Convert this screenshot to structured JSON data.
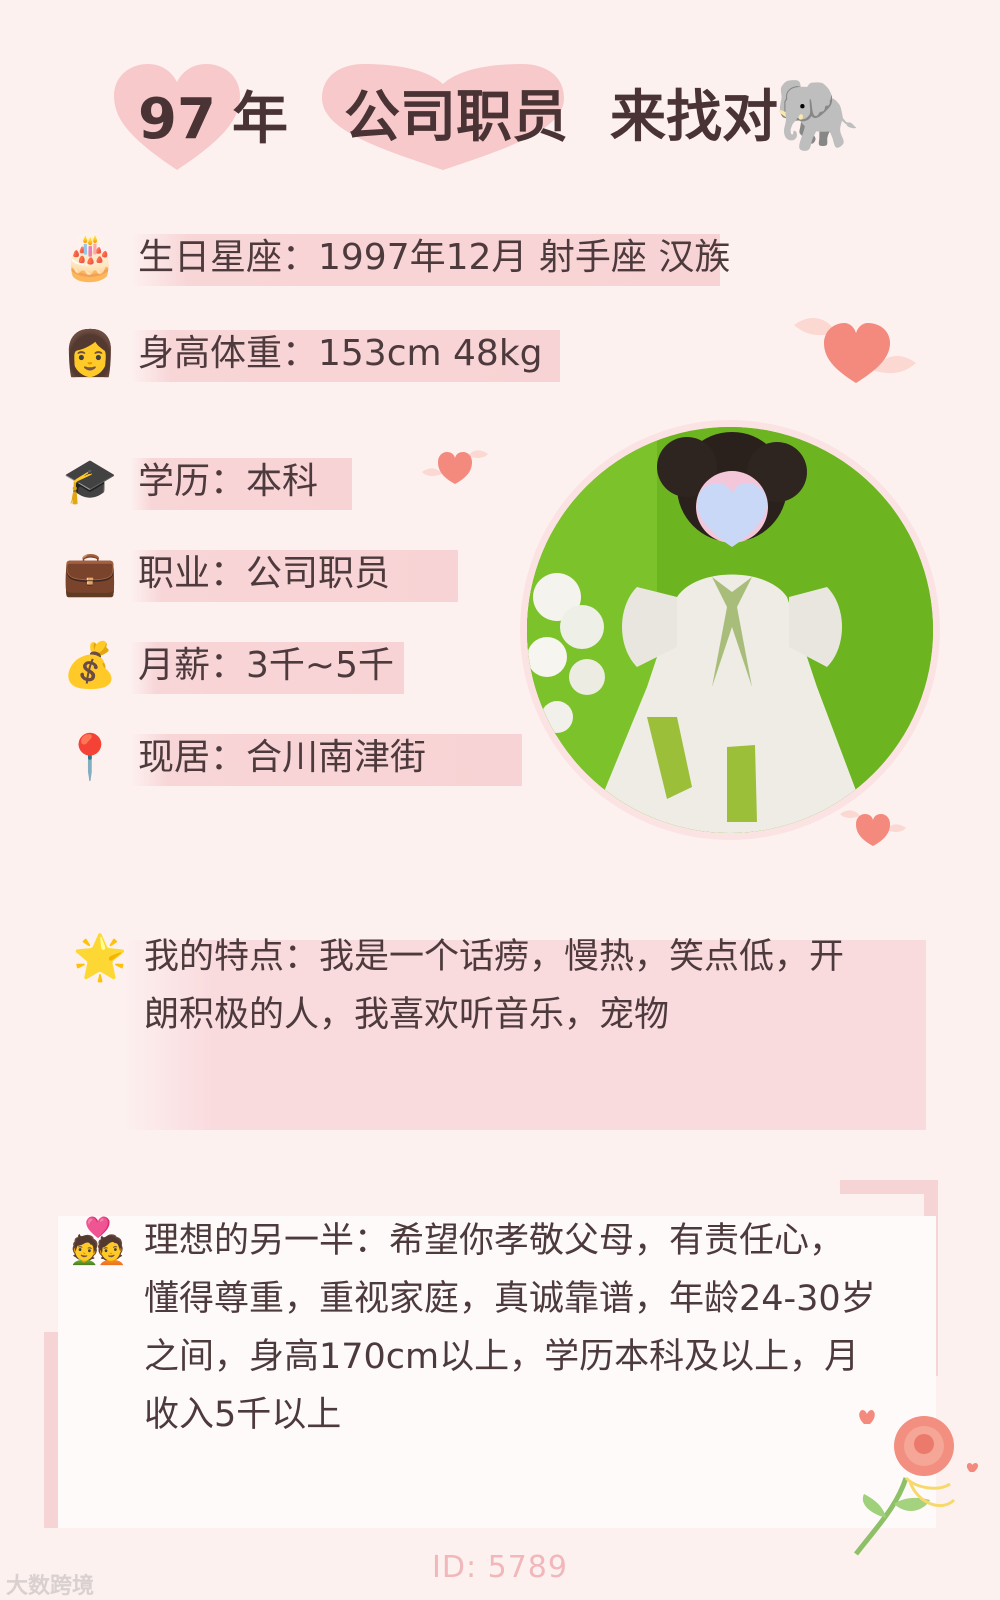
{
  "header": {
    "year": "97",
    "year_suffix": "年",
    "occupation": "公司职员",
    "tagline": "来找对",
    "emoji": "🐘"
  },
  "info": {
    "birthday": {
      "icon": "🎂",
      "icon_name": "birthday-cake-icon",
      "text": "生日星座：1997年12月 射手座 汉族"
    },
    "height_weight": {
      "icon": "👩",
      "icon_name": "woman-icon",
      "text": "身高体重：153cm 48kg"
    },
    "education": {
      "icon": "🎓",
      "icon_name": "graduation-cap-icon",
      "text": "学历：本科"
    },
    "job": {
      "icon": "💼",
      "icon_name": "briefcase-icon",
      "text": "职业：公司职员"
    },
    "salary": {
      "icon": "💰",
      "icon_name": "money-bag-icon",
      "text": "月薪：3千~5千"
    },
    "residence": {
      "icon": "📍",
      "icon_name": "location-pin-icon",
      "text": "现居：合川南津街"
    }
  },
  "features": {
    "icon": "🌟",
    "line1": "我的特点：我是一个话痨，慢热，笑点低，开",
    "line2": "朗积极的人，我喜欢听音乐，宠物"
  },
  "ideal": {
    "icon": "💑",
    "line1": "理想的另一半：希望你孝敬父母，有责任心，",
    "line2": "懂得尊重，重视家庭，真诚靠谱，年龄24-30岁",
    "line3": "之间，身高170cm以上，学历本科及以上，月",
    "line4": "收入5千以上"
  },
  "footer": {
    "id": "ID: 5789",
    "watermark": "大数跨境"
  },
  "colors": {
    "background": "#fdf1f0",
    "bar": "#f8d3d5",
    "heart": "#f6c9cc",
    "accent_heart": "#f17f77",
    "id_text": "#f1b7ba"
  }
}
